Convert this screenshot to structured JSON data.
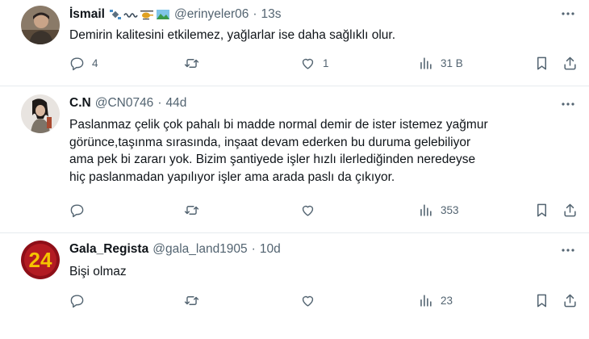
{
  "tweets": [
    {
      "name": "İsmail",
      "handle": "@erinyeler06",
      "separator": "·",
      "time": "13s",
      "avatar_color": "#6b5a48",
      "text_lines": [
        "Demirin kalitesini etkilemez, yağlarlar ise daha sağlıklı olur."
      ],
      "actions": {
        "reply_count": "4",
        "retweet_count": "",
        "like_count": "1",
        "views_count": "31 B"
      }
    },
    {
      "name": "C.N",
      "handle": "@CN0746",
      "separator": "·",
      "time": "44d",
      "avatar_color": "#d9d2cc",
      "text_lines": [
        "Paslanmaz çelik çok pahalı bi madde normal demir de ister istemez yağmur",
        "görünce,taşınma sırasında, inşaat devam ederken bu duruma gelebiliyor",
        "ama pek bi zararı yok. Bizim şantiyede işler hızlı ilerlediğinden neredeyse",
        "hiç paslanmadan yapılıyor işler ama arada paslı da çıkıyor."
      ],
      "actions": {
        "reply_count": "",
        "retweet_count": "",
        "like_count": "",
        "views_count": "353"
      }
    },
    {
      "name": "Gala_Regista",
      "handle": "@gala_land1905",
      "separator": "·",
      "time": "10d",
      "avatar_color": "#a3121c",
      "avatar_text": "24",
      "text_lines": [
        "Bişi olmaz"
      ],
      "actions": {
        "reply_count": "",
        "retweet_count": "",
        "like_count": "",
        "views_count": "23"
      }
    }
  ],
  "colors": {
    "text": "#0f1419",
    "secondary": "#536471",
    "divider": "#e6ebee"
  }
}
